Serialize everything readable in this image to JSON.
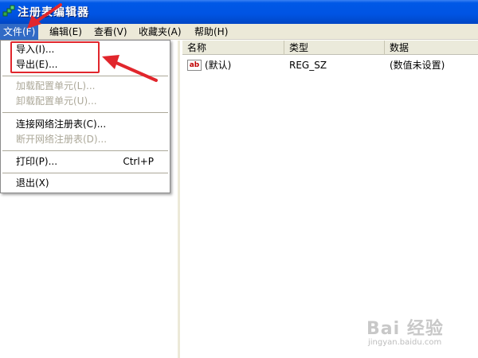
{
  "window": {
    "title": "注册表编辑器"
  },
  "menubar": {
    "items": [
      {
        "label": "文件(F)"
      },
      {
        "label": "编辑(E)"
      },
      {
        "label": "查看(V)"
      },
      {
        "label": "收藏夹(A)"
      },
      {
        "label": "帮助(H)"
      }
    ]
  },
  "file_menu": {
    "import": "导入(I)...",
    "export": "导出(E)...",
    "load_hive": "加载配置单元(L)...",
    "unload_hive": "卸载配置单元(U)...",
    "connect": "连接网络注册表(C)...",
    "disconnect": "断开网络注册表(D)...",
    "print": "打印(P)...",
    "print_shortcut": "Ctrl+P",
    "exit": "退出(X)"
  },
  "list": {
    "columns": [
      "名称",
      "类型",
      "数据"
    ],
    "rows": [
      {
        "name": "(默认)",
        "type": "REG_SZ",
        "data": "(数值未设置)",
        "icon": "string-value-icon",
        "icon_text": "ab"
      }
    ]
  },
  "annotation": {
    "color": "#e1262c"
  },
  "watermark": {
    "main": "Bai 经验",
    "sub": "jingyan.baidu.com"
  },
  "colors": {
    "titlebar": "#0054e3",
    "menu_highlight": "#316ac5",
    "menubar": "#ece9d8",
    "disabled_text": "#aca899"
  }
}
